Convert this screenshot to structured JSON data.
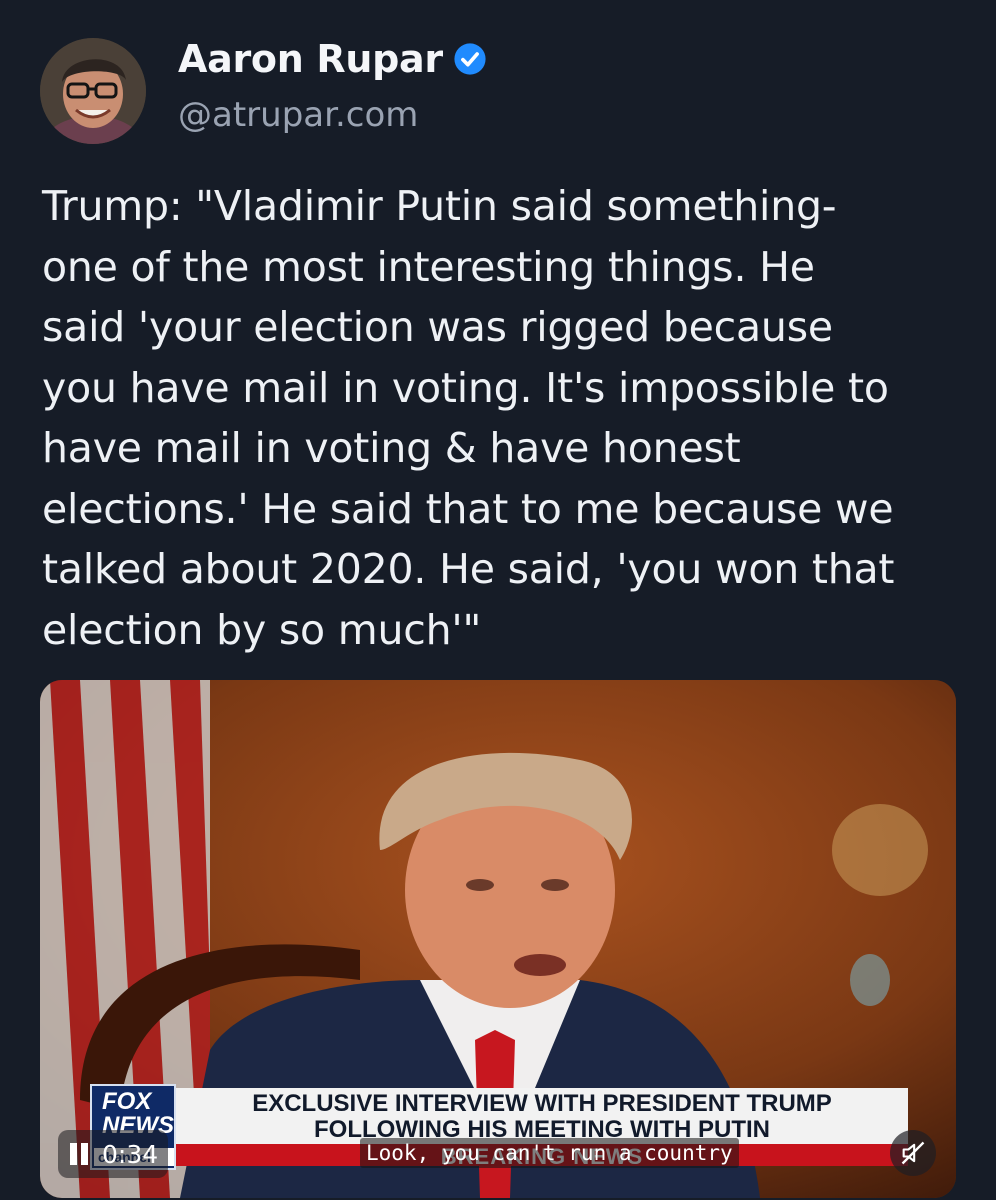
{
  "author": {
    "display_name": "Aaron Rupar",
    "handle": "@atrupar.com",
    "verified": true,
    "avatar_icon": "user-avatar-photo",
    "verified_icon": "verified-check-badge-icon",
    "verified_color": "#208bfe"
  },
  "post": {
    "text": "Trump: \"Vladimir Putin said something-\none of the most interesting things. He\nsaid 'your election was rigged because\nyou have mail in voting. It's impossible to\nhave mail in voting & have honest\nelections.' He said that to me because we\ntalked about 2020. He said, 'you won that\nelection by so much'\""
  },
  "video": {
    "network_logo_top": "FOX\nNEWS",
    "network_logo_bottom": "channel",
    "headline": "EXCLUSIVE INTERVIEW WITH PRESIDENT TRUMP\nFOLLOWING HIS MEETING WITH PUTIN",
    "ticker": "BREAKING NEWS",
    "time": "0:34",
    "caption": "Look, you can't run a country",
    "pause_icon": "pause-icon",
    "mute_icon": "speaker-muted-icon"
  },
  "colors": {
    "background": "#161c27",
    "text": "#eef1f5",
    "handle": "#9aa3b2"
  }
}
